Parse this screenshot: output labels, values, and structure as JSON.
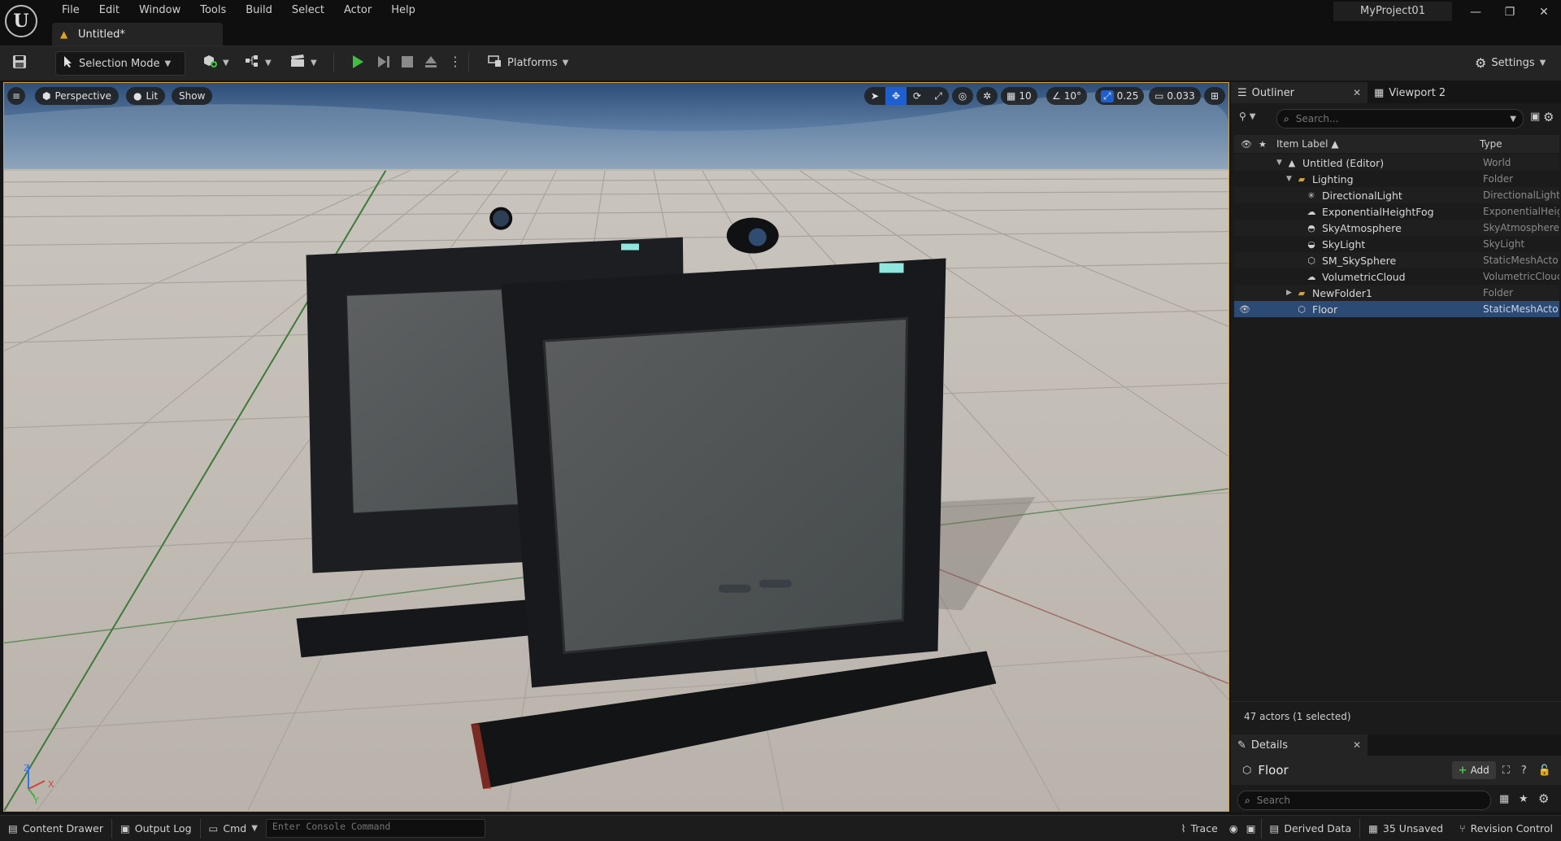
{
  "menu": [
    "File",
    "Edit",
    "Window",
    "Tools",
    "Build",
    "Select",
    "Actor",
    "Help"
  ],
  "document_tab": {
    "label": "Untitled*"
  },
  "project_name": "MyProject01",
  "window_controls": [
    "minimize-icon",
    "restore-icon",
    "close-icon"
  ],
  "toolbar": {
    "selection_mode": "Selection Mode",
    "platforms": "Platforms",
    "settings": "Settings",
    "play_color": "#3fbf3f"
  },
  "viewport": {
    "perspective": "Perspective",
    "lit": "Lit",
    "show": "Show",
    "grid_snap": "10",
    "rotate_snap": "10°",
    "scale_snap": "0.25",
    "camera_speed": "0.033",
    "axis_x": "X",
    "axis_y": "Y",
    "axis_z": "Z"
  },
  "outliner": {
    "tab_label": "Outliner",
    "viewport2_label": "Viewport 2",
    "search_placeholder": "Search...",
    "col_label": "Item Label",
    "col_type": "Type",
    "rows": [
      {
        "label": "Untitled (Editor)",
        "type": "World",
        "icon": "world-icon"
      },
      {
        "label": "Lighting",
        "type": "Folder",
        "icon": "folder-icon"
      },
      {
        "label": "DirectionalLight",
        "type": "DirectionalLight",
        "icon": "sun-icon"
      },
      {
        "label": "ExponentialHeightFog",
        "type": "ExponentialHeig",
        "icon": "fog-icon"
      },
      {
        "label": "SkyAtmosphere",
        "type": "SkyAtmosphere",
        "icon": "atmosphere-icon"
      },
      {
        "label": "SkyLight",
        "type": "SkyLight",
        "icon": "skylight-icon"
      },
      {
        "label": "SM_SkySphere",
        "type": "StaticMeshActo",
        "icon": "static-mesh-icon"
      },
      {
        "label": "VolumetricCloud",
        "type": "VolumetricClouc",
        "icon": "cloud-icon"
      },
      {
        "label": "NewFolder1",
        "type": "Folder",
        "icon": "folder-icon"
      },
      {
        "label": "Floor",
        "type": "StaticMeshActo",
        "icon": "static-mesh-icon"
      }
    ],
    "status": "47 actors (1 selected)"
  },
  "details": {
    "tab_label": "Details",
    "object_name": "Floor",
    "add_label": "Add",
    "search_placeholder": "Search"
  },
  "statusbar": {
    "content_drawer": "Content Drawer",
    "output_log": "Output Log",
    "cmd": "Cmd",
    "console_placeholder": "Enter Console Command",
    "trace": "Trace",
    "derived_data": "Derived Data",
    "unsaved": "35 Unsaved",
    "revision_control": "Revision Control"
  }
}
